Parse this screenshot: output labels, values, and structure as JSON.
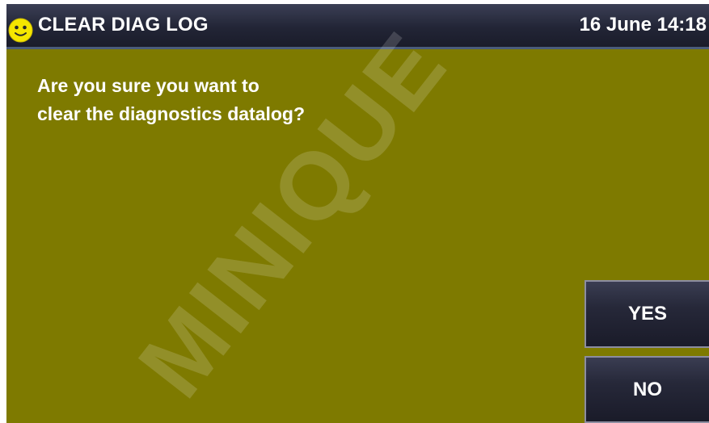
{
  "header": {
    "title": "CLEAR DIAG LOG",
    "datetime": "16 June 14:18",
    "status_icon": "smiley-face-icon"
  },
  "dialog": {
    "message_lines": [
      "Are you sure you want to",
      "clear the diagnostics datalog?"
    ]
  },
  "buttons": {
    "yes_label": "YES",
    "no_label": "NO"
  },
  "watermark": {
    "text": "MINIQUE"
  },
  "colors": {
    "background": "#7e7a00",
    "titlebar": "#222536",
    "button": "#262839",
    "icon": "#f5e600",
    "text": "#ffffff"
  }
}
